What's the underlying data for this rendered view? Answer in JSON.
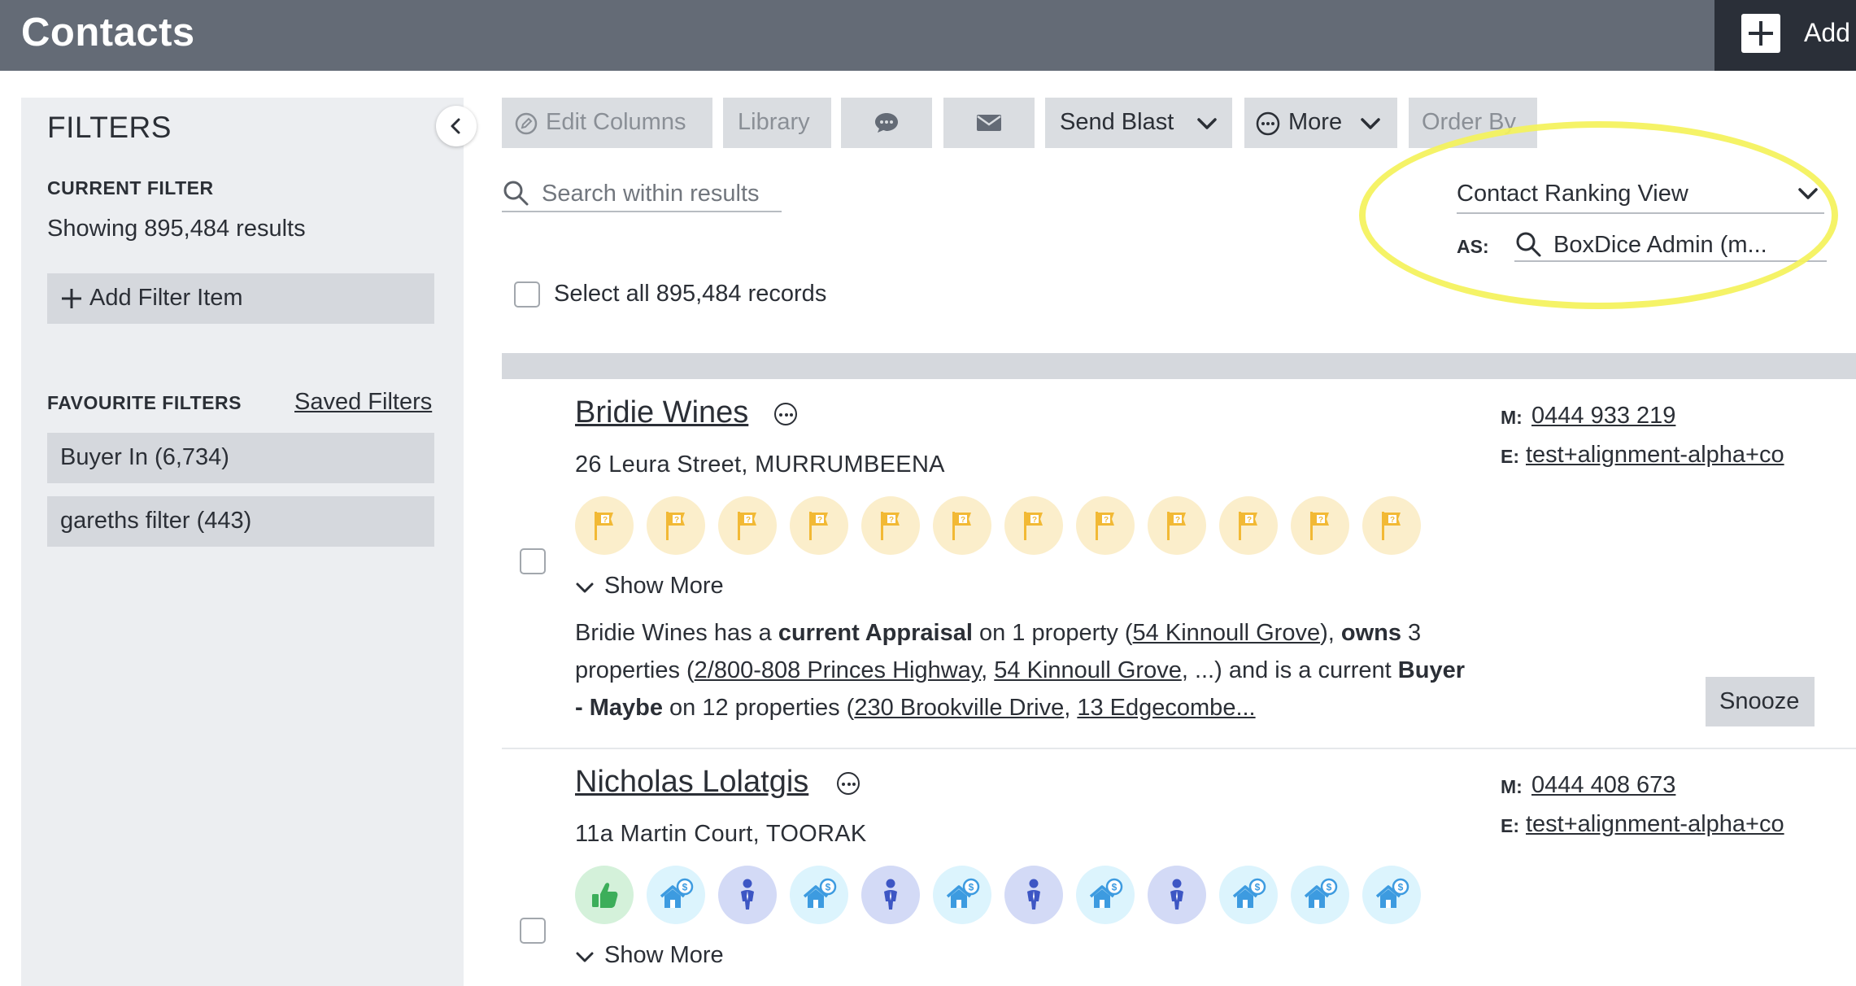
{
  "header": {
    "title": "Contacts",
    "add_label": "Add"
  },
  "sidebar": {
    "title": "FILTERS",
    "current_filter_heading": "CURRENT FILTER",
    "showing_text": "Showing 895,484 results",
    "add_filter_label": "Add Filter Item",
    "favourite_heading": "FAVOURITE FILTERS",
    "saved_filters_link": "Saved Filters",
    "favourites": [
      {
        "label": "Buyer In (6,734)"
      },
      {
        "label": "gareths filter (443)"
      }
    ]
  },
  "toolbar": {
    "edit_columns": "Edit Columns",
    "library": "Library",
    "send_blast": "Send Blast",
    "more": "More",
    "order_by": "Order By"
  },
  "search": {
    "placeholder": "Search within results"
  },
  "view": {
    "selected": "Contact Ranking View",
    "as_label": "AS:",
    "as_value": "BoxDice Admin (m..."
  },
  "select_all_label": "Select all 895,484 records",
  "contacts": [
    {
      "name": "Bridie Wines",
      "address": "26 Leura Street, MURRUMBEENA",
      "icons": [
        "flag-question-icon",
        "flag-question-icon",
        "flag-question-icon",
        "flag-question-icon",
        "flag-question-icon",
        "flag-question-icon",
        "flag-question-icon",
        "flag-question-icon",
        "flag-question-icon",
        "flag-question-icon",
        "flag-question-icon",
        "flag-question-icon"
      ],
      "show_more": "Show More",
      "mobile_label": "M:",
      "mobile": "0444 933 219",
      "email_label": "E:",
      "email": "test+alignment-alpha+co",
      "snooze": "Snooze",
      "desc": {
        "p1": "Bridie Wines has a ",
        "b1": "current Appraisal",
        "p2": " on 1 property (",
        "l1": "54 Kinnoull Grove",
        "p3": "), ",
        "b2": "owns",
        "p4": " 3 properties (",
        "l2": "2/800-808 Princes Highway",
        "p5": ", ",
        "l3": "54 Kinnoull Grove",
        "p6": ", ...) and is a current ",
        "b3": "Buyer - Maybe",
        "p7": " on 12 properties (",
        "l4": "230 Brookville Drive",
        "p8": ", ",
        "l5": "13 Edgecombe..."
      }
    },
    {
      "name": "Nicholas Lolatgis",
      "address": "11a Martin Court, TOORAK",
      "icons": [
        "thumbs-up-icon",
        "house-dollar-icon",
        "person-icon",
        "house-dollar-icon",
        "person-icon",
        "house-dollar-icon",
        "person-icon",
        "house-dollar-icon",
        "person-icon",
        "house-dollar-icon",
        "house-dollar-icon",
        "house-dollar-icon"
      ],
      "show_more": "Show More",
      "mobile_label": "M:",
      "mobile": "0444 408 673",
      "email_label": "E:",
      "email": "test+alignment-alpha+co"
    }
  ],
  "colors": {
    "header_bg": "#646b76",
    "highlight": "#f4f25a",
    "flag": "#f2b935",
    "thumb": "#3cae5a",
    "house": "#3d9be0",
    "person": "#3d56c4"
  }
}
